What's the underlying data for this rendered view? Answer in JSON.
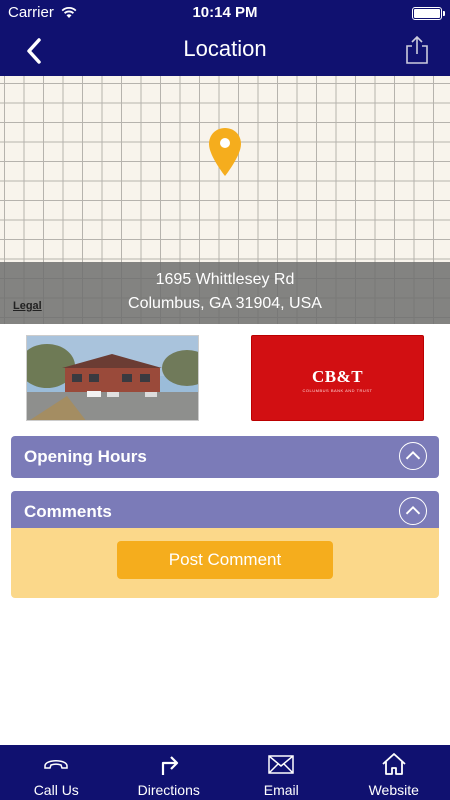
{
  "status_bar": {
    "carrier": "Carrier",
    "time": "10:14 PM"
  },
  "nav": {
    "title": "Location"
  },
  "map": {
    "address_line1": "1695 Whittlesey Rd",
    "address_line2": "Columbus, GA 31904, USA",
    "legal": "Legal",
    "pin_color": "#f5ad1d"
  },
  "logo": {
    "text": "CB&T",
    "subtitle": "COLUMBUS BANK AND TRUST"
  },
  "sections": {
    "opening_hours": "Opening Hours",
    "comments": "Comments",
    "post_comment": "Post Comment"
  },
  "tabs": [
    {
      "label": "Call Us",
      "icon": "phone-icon"
    },
    {
      "label": "Directions",
      "icon": "directions-icon"
    },
    {
      "label": "Email",
      "icon": "envelope-icon"
    },
    {
      "label": "Website",
      "icon": "home-icon"
    }
  ],
  "colors": {
    "nav": "#101170",
    "section_header": "#7b7bb8",
    "comments_body": "#fbd88a",
    "accent": "#f5ad1d",
    "logo_bg": "#d20f12"
  }
}
